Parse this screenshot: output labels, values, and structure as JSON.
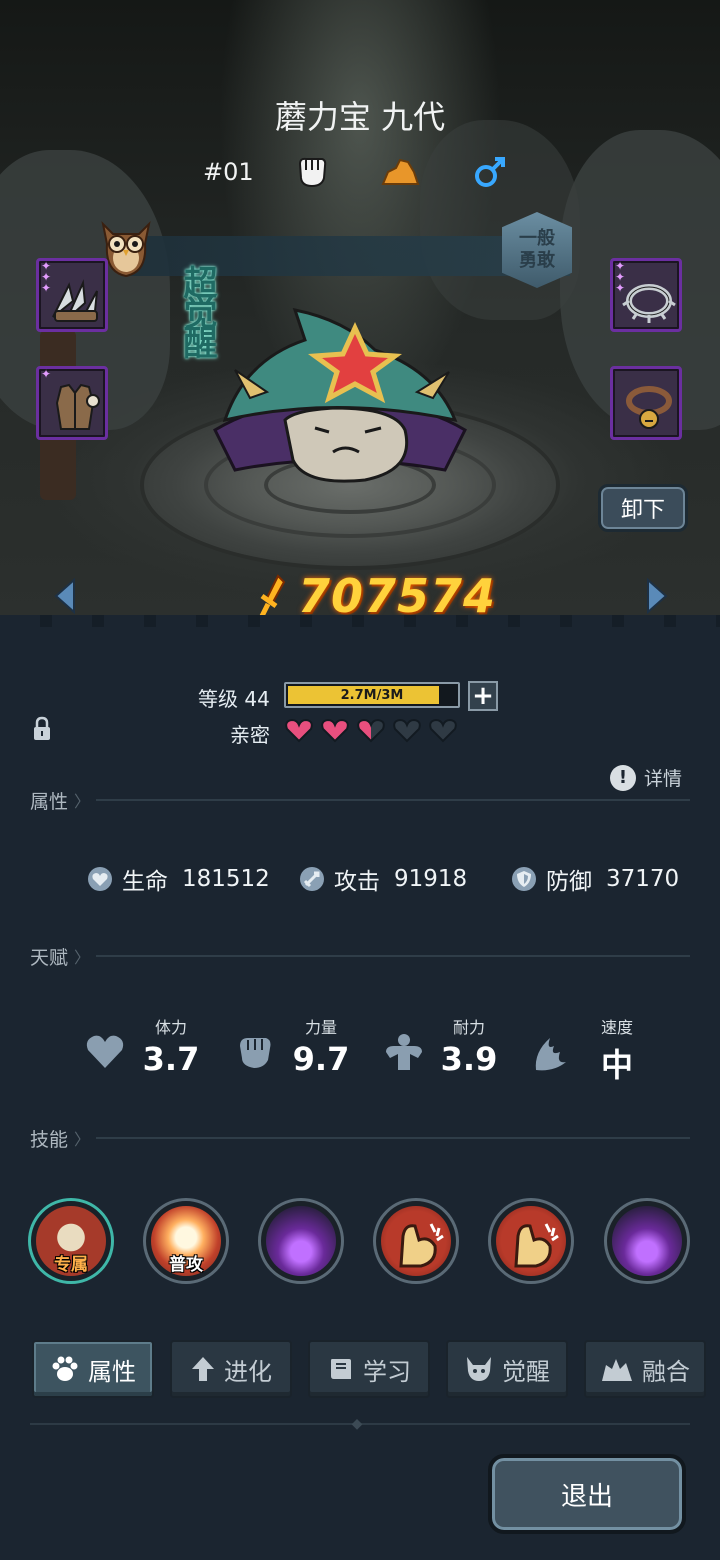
{
  "pet": {
    "name": "蘑力宝 九代",
    "number": "#01",
    "rank_line1": "一般",
    "rank_line2": "勇敢",
    "awaken_tag": "超觉醒",
    "power": "707574"
  },
  "traits": [
    "fist-icon",
    "rock-icon",
    "male-icon"
  ],
  "equipment": {
    "left": [
      "claw-blade",
      "leather-vest"
    ],
    "right": [
      "spiked-ring",
      "bell-collar"
    ],
    "unequip_label": "卸下"
  },
  "level": {
    "label": "等级 44",
    "exp_text": "2.7M/3M",
    "exp_fraction": 0.9,
    "plus": "+"
  },
  "intimacy": {
    "label": "亲密",
    "hearts": [
      1,
      1,
      0.5,
      0,
      0
    ],
    "color_full": "#e84f7e",
    "color_empty": "#2f3a44"
  },
  "detail_label": "详情",
  "sections": {
    "attributes": "属性",
    "talents": "天赋",
    "skills": "技能"
  },
  "attributes": [
    {
      "icon": "heart-shield-icon",
      "label": "生命",
      "value": "181512"
    },
    {
      "icon": "sword-icon",
      "label": "攻击",
      "value": "91918"
    },
    {
      "icon": "shield-icon",
      "label": "防御",
      "value": "37170"
    }
  ],
  "talents": [
    {
      "icon": "heart-icon",
      "label": "体力",
      "value": "3.7"
    },
    {
      "icon": "fist-icon",
      "label": "力量",
      "value": "9.7"
    },
    {
      "icon": "muscle-icon",
      "label": "耐力",
      "value": "3.9"
    },
    {
      "icon": "wing-icon",
      "label": "速度",
      "value": "中"
    }
  ],
  "skills": [
    {
      "name": "skull-burst",
      "tag": "专属"
    },
    {
      "name": "burst-attack",
      "tag": "普攻"
    },
    {
      "name": "dark-spikes",
      "tag": ""
    },
    {
      "name": "arm-strike",
      "tag": ""
    },
    {
      "name": "arm-strike",
      "tag": ""
    },
    {
      "name": "dark-spikes",
      "tag": ""
    }
  ],
  "tabs": [
    {
      "label": "属性",
      "icon": "paw-icon",
      "active": true
    },
    {
      "label": "进化",
      "icon": "up-arrow-icon",
      "active": false
    },
    {
      "label": "学习",
      "icon": "book-icon",
      "active": false
    },
    {
      "label": "觉醒",
      "icon": "demon-icon",
      "active": false
    },
    {
      "label": "融合",
      "icon": "fusion-icon",
      "active": false
    }
  ],
  "exit_label": "退出",
  "colors": {
    "accent_gold": "#ffd23c",
    "panel_bg": "#1b2530",
    "equip_border": "#6b2fa0"
  }
}
